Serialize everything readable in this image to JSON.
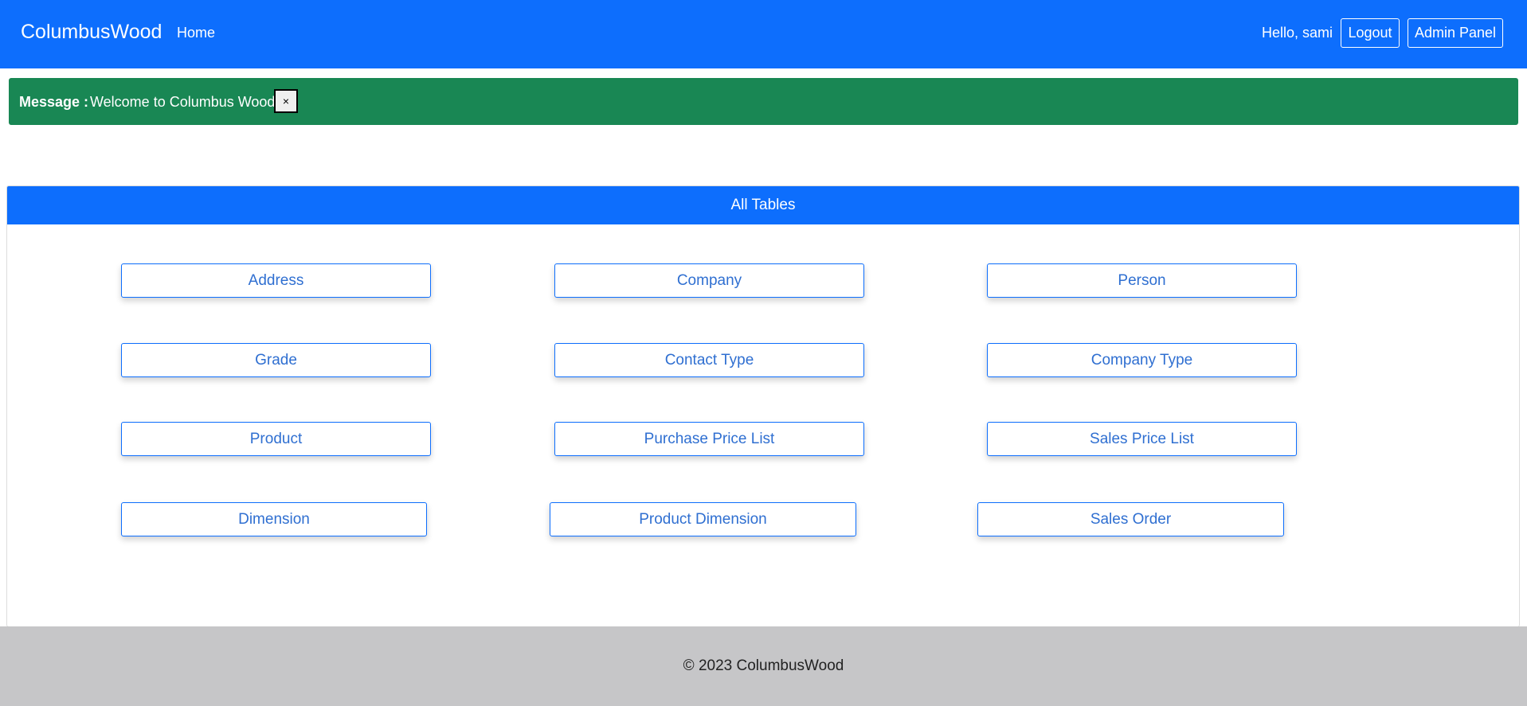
{
  "navbar": {
    "brand": "ColumbusWood",
    "home": "Home",
    "greeting": "Hello, sami",
    "logout": "Logout",
    "admin_panel": "Admin Panel"
  },
  "alert": {
    "label": "Message :",
    "text": "Welcome to Columbus Wood",
    "close": "×"
  },
  "card": {
    "title": "All Tables",
    "tables": [
      "Address",
      "Company",
      "Person",
      "Grade",
      "Contact Type",
      "Company Type",
      "Product",
      "Purchase Price List",
      "Sales Price List",
      "Dimension",
      "Product Dimension",
      "Sales Order"
    ]
  },
  "footer": {
    "text": "© 2023 ColumbusWood"
  },
  "colors": {
    "primary": "#0d6efd",
    "success": "#198754",
    "footer_bg": "#c6c6c8"
  }
}
